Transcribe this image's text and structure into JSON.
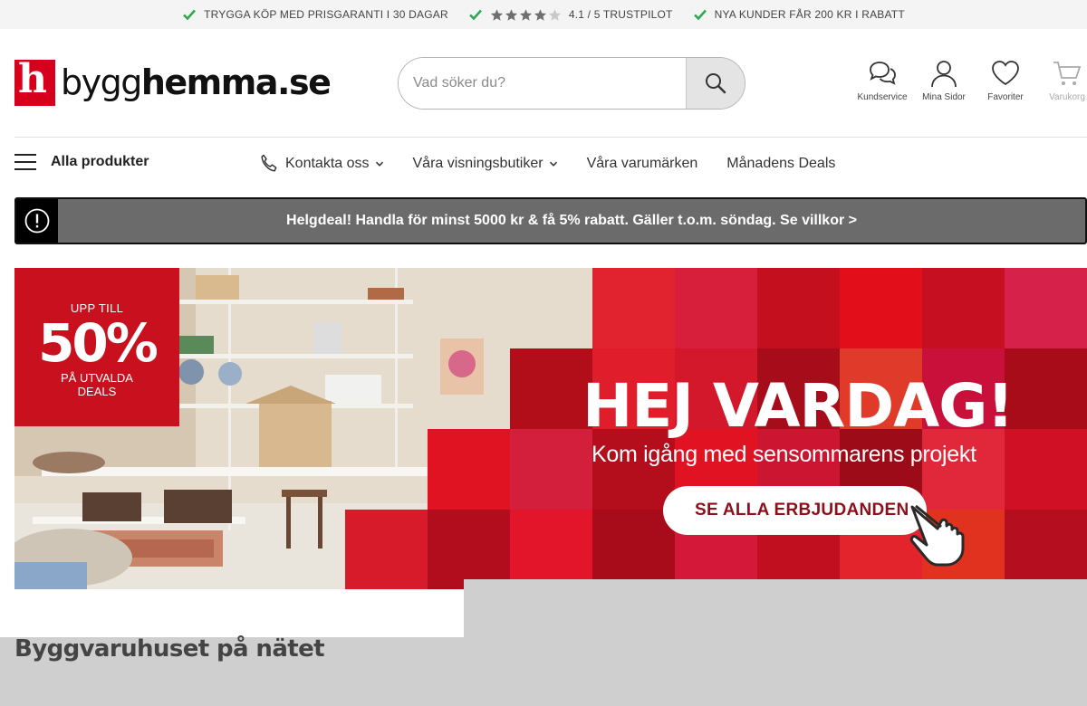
{
  "usp": {
    "item1": "TRYGGA KÖP MED PRISGARANTI I 30 DAGAR",
    "rating": "4.1 / 5 TRUSTPILOT",
    "rating_value": 4.1,
    "item3": "NYA KUNDER FÅR 200 KR I RABATT",
    "check_color": "#2fa84f"
  },
  "header": {
    "logo_letter": "h",
    "logo_text_regular": "bygg",
    "logo_text_bold": "hemma.se",
    "search_placeholder": "Vad söker du?",
    "icons": {
      "customer_service": "Kundservice",
      "my_pages": "Mina Sidor",
      "favorites": "Favoriter",
      "cart": "Varukorg"
    }
  },
  "nav": {
    "all_products": "Alla produkter",
    "links": [
      "Kontakta oss",
      "Våra visningsbutiker",
      "Våra varumärken",
      "Månadens Deals"
    ]
  },
  "promo": {
    "text": "Helgdeal! Handla för minst 5000 kr & få 5% rabatt. Gäller t.o.m. söndag. Se villkor >"
  },
  "hero": {
    "badge_top": "UPP TILL",
    "badge_percent": "50%",
    "badge_line1": "PÅ UTVALDA",
    "badge_line2": "DEALS",
    "title": "HEJ VARDAG!",
    "subtitle": "Kom igång med sensommarens projekt",
    "cta": "SE ALLA ERBJUDANDEN",
    "brand_red": "#d6001c"
  },
  "section": {
    "title": "Byggvaruhuset på nätet"
  }
}
